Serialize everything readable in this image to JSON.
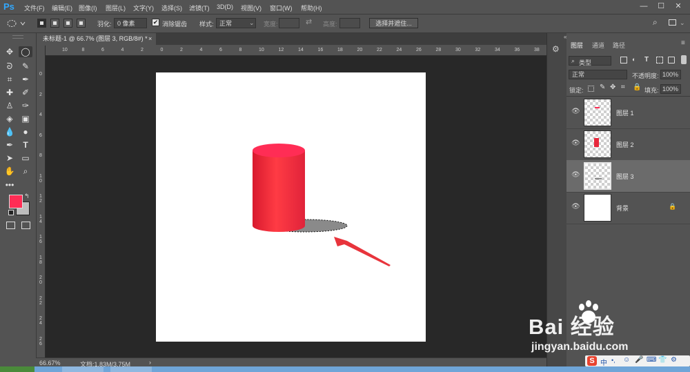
{
  "app": {
    "logo": "Ps"
  },
  "menu": [
    "文件(F)",
    "编辑(E)",
    "图像(I)",
    "图层(L)",
    "文字(Y)",
    "选择(S)",
    "滤镜(T)",
    "3D(D)",
    "视图(V)",
    "窗口(W)",
    "帮助(H)"
  ],
  "window_controls": {
    "minimize": "—",
    "maximize": "☐",
    "close": "✕"
  },
  "options": {
    "feather_label": "羽化:",
    "feather_value": "0 像素",
    "antialias_label": "消除锯齿",
    "antialias_checked": true,
    "style_label": "样式:",
    "style_value": "正常",
    "width_label": "宽度:",
    "height_label": "高度:",
    "select_mask_button": "选择并遮住..."
  },
  "document": {
    "tab_title": "未标题-1 @ 66.7% (图层 3, RGB/8#) *",
    "close_glyph": "×"
  },
  "ruler_top_labels": [
    "10",
    "8",
    "6",
    "4",
    "2",
    "0",
    "2",
    "4",
    "6",
    "8",
    "10",
    "12",
    "14",
    "16",
    "18",
    "20",
    "22",
    "24",
    "26",
    "28",
    "30",
    "32",
    "34",
    "36",
    "38"
  ],
  "ruler_left_labels": [
    "0",
    "2",
    "4",
    "6",
    "8",
    "1 0",
    "1 2",
    "1 4",
    "1 6",
    "1 8",
    "2 0",
    "2 2",
    "2 4",
    "2 6"
  ],
  "colors": {
    "foreground": "#ff2d55",
    "background": "#bdbdbd",
    "cylinder_top": "#ff2d55",
    "cylinder_body": "#e8283c",
    "arrow": "#e8343c",
    "shadow": "#8a8a8a"
  },
  "status": {
    "zoom": "66.67%",
    "doc_info": "文档:1.83M/3.75M",
    "arrow": "›"
  },
  "layers_panel": {
    "tabs": [
      "图层",
      "通道",
      "路径"
    ],
    "filter_label": "类型",
    "blend_mode": "正常",
    "opacity_label": "不透明度:",
    "opacity_value": "100%",
    "lock_label": "锁定:",
    "fill_label": "填充:",
    "fill_value": "100%",
    "layers": [
      {
        "name": "图层 1",
        "visible": true,
        "active": false
      },
      {
        "name": "图层 2",
        "visible": true,
        "active": false
      },
      {
        "name": "图层 3",
        "visible": true,
        "active": true
      },
      {
        "name": "背景",
        "visible": true,
        "active": false,
        "locked": true
      }
    ]
  },
  "watermark": {
    "brand": "Bai 经验",
    "url": "jingyan.baidu.com"
  },
  "ime_bar": {
    "label": "中",
    "s_glyph": "S"
  }
}
